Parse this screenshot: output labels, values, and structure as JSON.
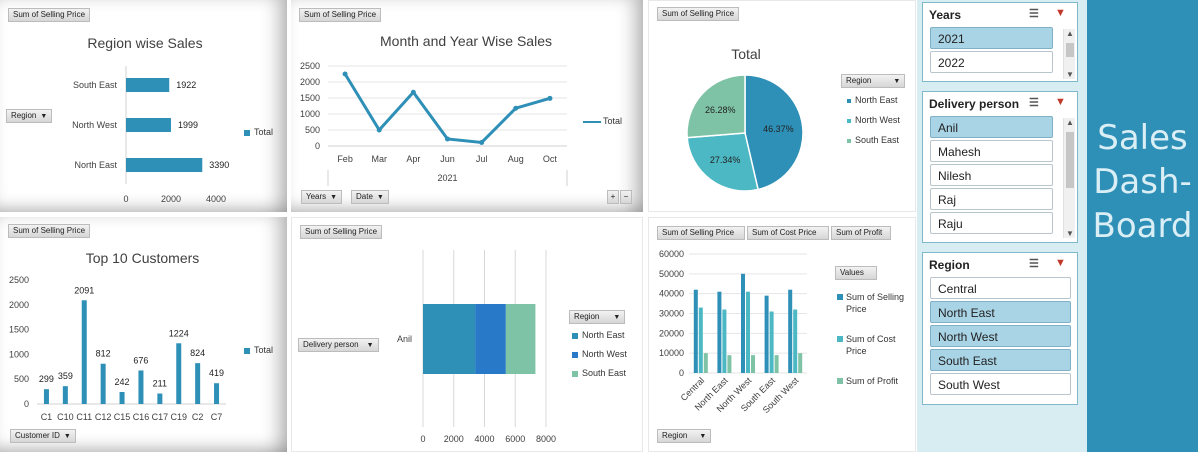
{
  "colors": {
    "teal": "#2e8fb7",
    "mid": "#4cb8c4",
    "green": "#7fc3a6",
    "darkblue": "#2879c8",
    "brand_bg": "#2e8fb7",
    "panel_bg": "#d7edf2"
  },
  "chart1": {
    "field_button": "Sum of Selling Price",
    "region_button": "Region",
    "legend": "Total",
    "chart_data": {
      "type": "bar",
      "title": "Region wise Sales",
      "categories": [
        "South East",
        "North West",
        "North East"
      ],
      "values": [
        1922,
        1999,
        3390
      ],
      "xlim": [
        0,
        4000
      ],
      "ticks": [
        "0",
        "2000",
        "4000"
      ],
      "series": [
        {
          "name": "Total",
          "values": [
            1922,
            1999,
            3390
          ]
        }
      ]
    }
  },
  "chart2": {
    "field_button": "Sum of Selling Price",
    "years_button": "Years",
    "date_button": "Date",
    "legend": "Total",
    "year_label": "2021",
    "zoom_plus": "+",
    "zoom_minus": "−",
    "chart_data": {
      "type": "line",
      "title": "Month and Year Wise Sales",
      "x": [
        "Feb",
        "Mar",
        "Apr",
        "Jun",
        "Jul",
        "Aug",
        "Oct"
      ],
      "y": [
        2250,
        500,
        1680,
        220,
        110,
        1180,
        1490
      ],
      "ylim": [
        0,
        2500
      ],
      "yticks": [
        "0",
        "500",
        "1000",
        "1500",
        "2000",
        "2500"
      ],
      "series": [
        {
          "name": "Total",
          "values": [
            2250,
            500,
            1680,
            220,
            110,
            1180,
            1490
          ]
        }
      ]
    }
  },
  "chart3": {
    "field_button": "Sum of Selling Price",
    "region_button": "Region",
    "legend": [
      "North East",
      "North West",
      "South East"
    ],
    "chart_data": {
      "type": "pie",
      "title": "Total",
      "categories": [
        "North East",
        "North West",
        "South East"
      ],
      "values": [
        46.37,
        27.34,
        26.28
      ],
      "labels": [
        "46.37%",
        "27.34%",
        "26.28%"
      ]
    }
  },
  "chart4": {
    "field_button": "Sum of Selling Price",
    "customer_button": "Customer ID",
    "legend": "Total",
    "chart_data": {
      "type": "bar",
      "title": "Top 10 Customers",
      "categories": [
        "C1",
        "C10",
        "C11",
        "C12",
        "C15",
        "C16",
        "C17",
        "C19",
        "C2",
        "C7"
      ],
      "values": [
        299,
        359,
        2091,
        812,
        242,
        676,
        211,
        1224,
        824,
        419
      ],
      "ylim": [
        0,
        2500
      ],
      "yticks": [
        "0",
        "500",
        "1000",
        "1500",
        "2000",
        "2500"
      ],
      "series": [
        {
          "name": "Total",
          "values": [
            299,
            359,
            2091,
            812,
            242,
            676,
            211,
            1224,
            824,
            419
          ]
        }
      ]
    }
  },
  "chart5": {
    "field_button": "Sum of Selling Price",
    "delivery_button": "Delivery person",
    "region_button": "Region",
    "legend": [
      "North East",
      "North West",
      "South East"
    ],
    "chart_data": {
      "type": "bar",
      "stacked": true,
      "categories": [
        "Anil"
      ],
      "series": [
        {
          "name": "North East",
          "values": [
            3390
          ]
        },
        {
          "name": "North West",
          "values": [
            1999
          ]
        },
        {
          "name": "South East",
          "values": [
            1922
          ]
        }
      ],
      "xlim": [
        0,
        8000
      ],
      "xticks": [
        "0",
        "2000",
        "4000",
        "6000",
        "8000"
      ]
    }
  },
  "chart6": {
    "field_buttons": [
      "Sum of Selling Price",
      "Sum of  Cost Price",
      "Sum of Profit"
    ],
    "region_button": "Region",
    "legend_title": "Values",
    "legend": [
      "Sum of Selling Price",
      "Sum of  Cost Price",
      "Sum of Profit"
    ],
    "chart_data": {
      "type": "bar",
      "categories": [
        "Central",
        "North East",
        "North West",
        "South East",
        "South West"
      ],
      "series": [
        {
          "name": "Sum of Selling Price",
          "values": [
            42000,
            41000,
            50000,
            39000,
            42000
          ]
        },
        {
          "name": "Sum of  Cost Price",
          "values": [
            33000,
            32000,
            41000,
            31000,
            32000
          ]
        },
        {
          "name": "Sum of Profit",
          "values": [
            10000,
            9000,
            9000,
            9000,
            10000
          ]
        }
      ],
      "ylim": [
        0,
        60000
      ],
      "yticks": [
        "0",
        "10000",
        "20000",
        "30000",
        "40000",
        "50000",
        "60000"
      ]
    }
  },
  "slicers": {
    "years": {
      "title": "Years",
      "items": [
        {
          "label": "2021",
          "selected": true
        },
        {
          "label": "2022",
          "selected": false
        }
      ]
    },
    "delivery": {
      "title": "Delivery person",
      "items": [
        {
          "label": "Anil",
          "selected": true
        },
        {
          "label": "Mahesh",
          "selected": false
        },
        {
          "label": "Nilesh",
          "selected": false
        },
        {
          "label": "Raj",
          "selected": false
        },
        {
          "label": "Raju",
          "selected": false
        }
      ]
    },
    "region": {
      "title": "Region",
      "items": [
        {
          "label": "Central",
          "selected": false
        },
        {
          "label": "North East",
          "selected": true
        },
        {
          "label": "North West",
          "selected": true
        },
        {
          "label": "South East",
          "selected": true
        },
        {
          "label": "South West",
          "selected": false
        }
      ]
    }
  },
  "brand": {
    "line1": "Sales",
    "line2": "Dash-",
    "line3": "Board"
  },
  "icons": {
    "multiselect": "multi-select-icon",
    "clear_filter": "clear-filter-icon",
    "filter": "filter-dropdown-icon"
  }
}
